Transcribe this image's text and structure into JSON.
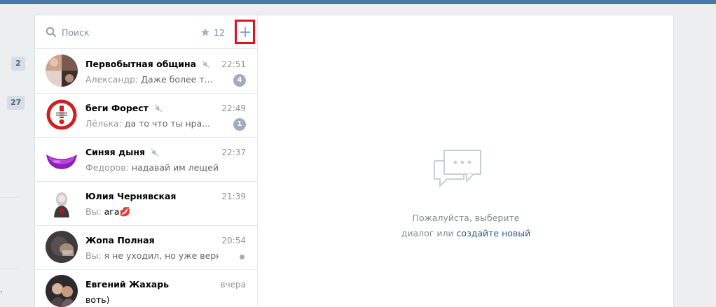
{
  "left_rail": {
    "badges": [
      "2",
      "27"
    ],
    "dot": "."
  },
  "search": {
    "placeholder": "Поиск",
    "favorites_count": "12"
  },
  "dialogs": [
    {
      "name": "Первобытная община",
      "muted": true,
      "time": "22:51",
      "author": "Александр:",
      "text": "Даже более т...",
      "unread": "4"
    },
    {
      "name": "беги Форест",
      "muted": true,
      "time": "22:49",
      "author": "Лёлька:",
      "text": "да то что ты нра...",
      "unread": "1"
    },
    {
      "name": "Синяя дыня",
      "muted": true,
      "time": "22:37",
      "author": "Федоров:",
      "text": "надавай им лещей",
      "unread": ""
    },
    {
      "name": "Юлия Чернявская",
      "muted": false,
      "time": "21:39",
      "author": "Вы:",
      "text": "ага💋",
      "unread": ""
    },
    {
      "name": "Жопа Полная",
      "muted": false,
      "time": "20:54",
      "author": "Вы:",
      "text": "я не уходил, но уже вернулся. ...",
      "unread": ""
    },
    {
      "name": "Евгений Жахарь",
      "muted": false,
      "time": "вчера",
      "author": "",
      "text": "воть)",
      "unread": ""
    }
  ],
  "empty_state": {
    "line1": "Пожалуйста, выберите",
    "line2_prefix": "диалог или",
    "create_link": "создайте новый"
  },
  "colors": {
    "header": "#4a76a8",
    "highlight": "#e3101f",
    "badge": "#a1adbf",
    "link": "#2a5885"
  }
}
